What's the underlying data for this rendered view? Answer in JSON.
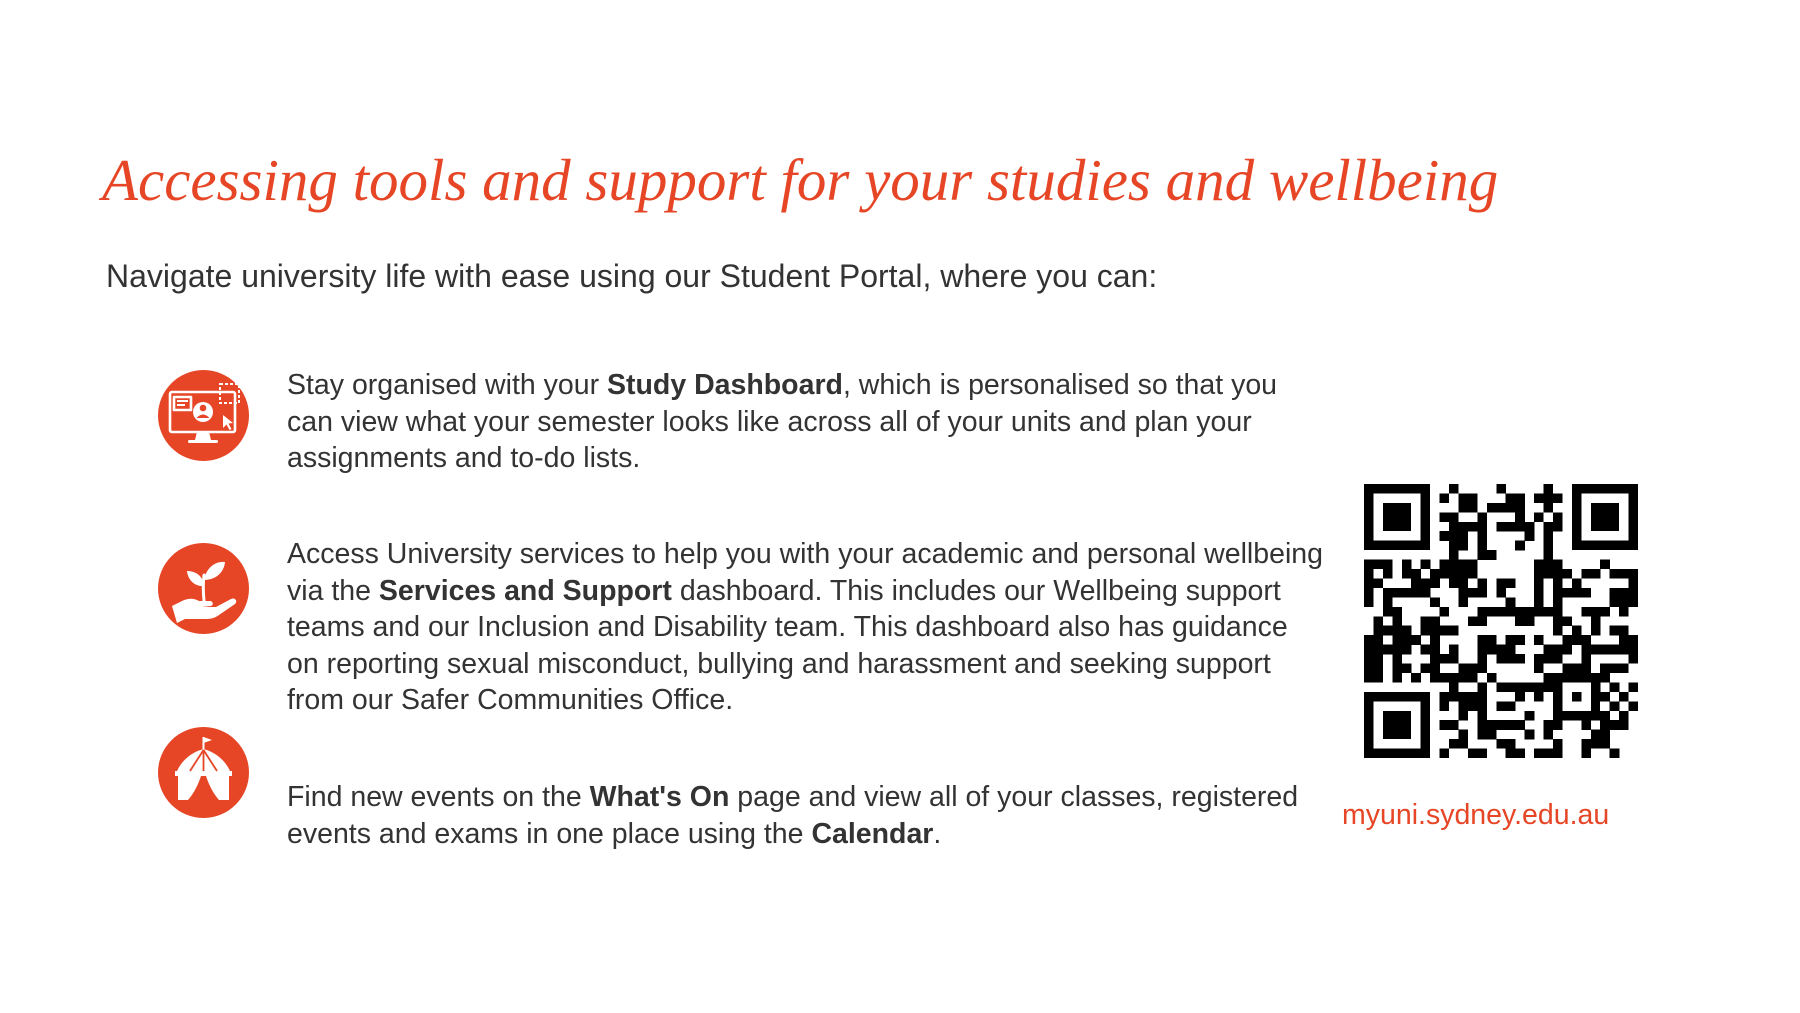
{
  "slide": {
    "title": "Accessing tools and support for your studies and wellbeing",
    "intro": "Navigate university life with ease using our Student Portal, where you can:",
    "accent_color": "#e64626",
    "text_color": "#333333"
  },
  "features": [
    {
      "icon": "dashboard-monitor-icon",
      "parts": [
        {
          "text": "Stay organised with your ",
          "bold": false
        },
        {
          "text": "Study Dashboard",
          "bold": true
        },
        {
          "text": ", which is personalised so that you can view what your semester looks like across all of your units and plan your assignments and to-do lists.",
          "bold": false
        }
      ]
    },
    {
      "icon": "hand-plant-icon",
      "parts": [
        {
          "text": "Access University services to help you with your academic and personal wellbeing via the ",
          "bold": false
        },
        {
          "text": "Services and Support",
          "bold": true
        },
        {
          "text": " dashboard. This includes our Wellbeing support teams and our Inclusion and Disability team. This dashboard also has guidance on reporting sexual misconduct, bullying and harassment and seeking support from our Safer Communities Office.",
          "bold": false
        }
      ]
    },
    {
      "icon": "event-tent-icon",
      "parts": [
        {
          "text": "Find new events on the ",
          "bold": false
        },
        {
          "text": "What's On",
          "bold": true
        },
        {
          "text": " page and view all of your classes, registered events and exams in one place using the ",
          "bold": false
        },
        {
          "text": "Calendar",
          "bold": true
        },
        {
          "text": ".",
          "bold": false
        }
      ]
    }
  ],
  "qr": {
    "icon": "qr-code-icon",
    "url_text": "myuni.sydney.edu.au"
  }
}
